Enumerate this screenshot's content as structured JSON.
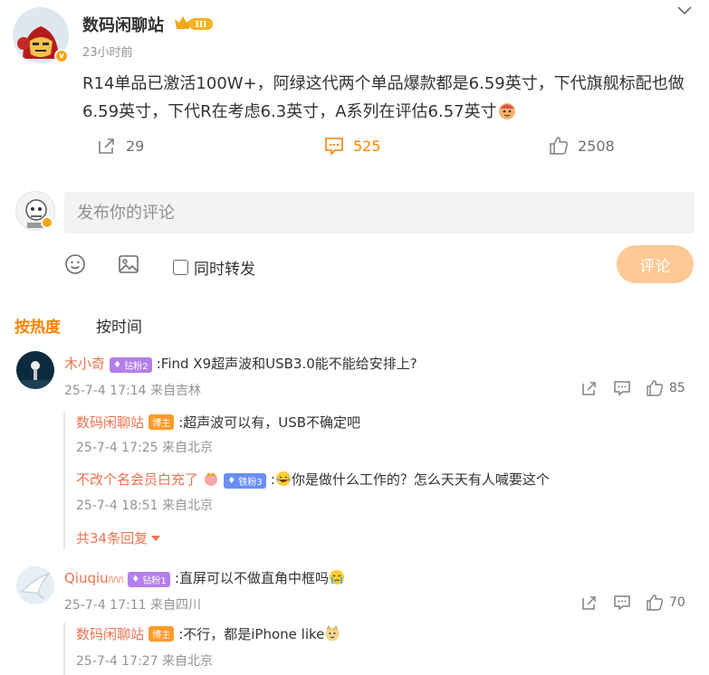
{
  "post": {
    "author": "数码闲聊站",
    "time": "23小时前",
    "text": "R14单品已激活100W+，阿绿这代两个单品爆款都是6.59英寸，下代旗舰标配也做6.59英寸，下代R在考虑6.3英寸，A系列在评估6.57英寸",
    "rank_badge": "III",
    "shares": "29",
    "comments": "525",
    "likes": "2508"
  },
  "composer": {
    "placeholder": "发布你的评论",
    "forward_label": "同时转发",
    "submit_label": "评论"
  },
  "sort": {
    "hot": "按热度",
    "time": "按时间"
  },
  "comments": [
    {
      "name": "木小奇",
      "tag": "钻粉2",
      "text": ":Find X9超声波和USB3.0能不能给安排上?",
      "meta": "25-7-4 17:14 来自吉林",
      "likes": "85",
      "replies": [
        {
          "name": "数码闲聊站",
          "tag": "博主",
          "text": ":超声波可以有，USB不确定吧",
          "meta": "25-7-4 17:25 来自北京"
        },
        {
          "name": "不改个名会员白充了",
          "tag": "铁粉3",
          "text": "你是做什么工作的？怎么天天有人喊要这个",
          "meta": "25-7-4 18:51 来自北京"
        }
      ],
      "more": "共34条回复"
    },
    {
      "name": "Qiuqiu",
      "tag": "钻粉1",
      "text": ":直屏可以不做直角中框吗",
      "meta": "25-7-4 17:11 来自四川",
      "likes": "70",
      "replies": [
        {
          "name": "数码闲聊站",
          "tag": "博主",
          "text": ":不行，都是iPhone like",
          "meta": "25-7-4 17:27 来自北京"
        }
      ]
    }
  ],
  "colors": {
    "accent": "#ff8200",
    "name": "#eb7350",
    "submit_disabled": "#ffc895"
  }
}
